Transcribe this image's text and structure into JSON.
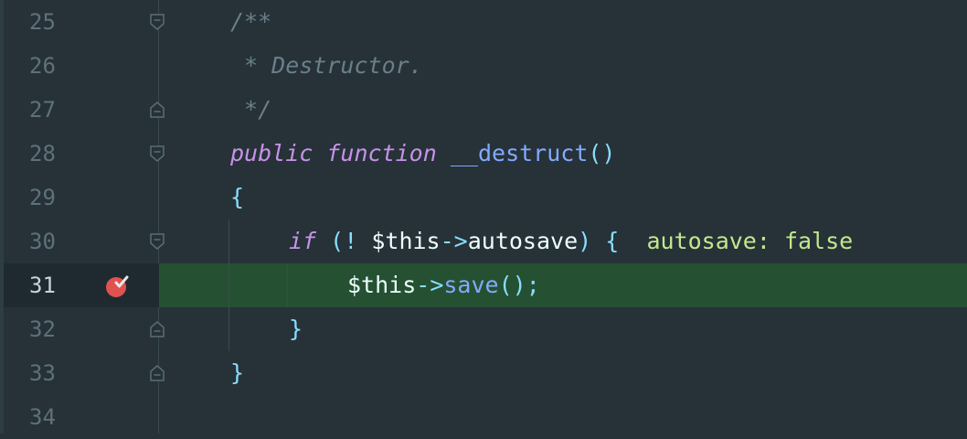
{
  "editor": {
    "colors": {
      "background": "#263238",
      "current_line": "#255132",
      "comment": "#6a7f89",
      "keyword": "#c792ea",
      "function": "#82aaff",
      "punctuation": "#89ddff",
      "inline_value": "#c3e88d",
      "breakpoint": "#e0524f"
    },
    "current_line": "31",
    "lines": [
      {
        "number": "25",
        "comment": "/**"
      },
      {
        "number": "26",
        "comment": " * Destructor."
      },
      {
        "number": "27",
        "comment": " */"
      },
      {
        "number": "28",
        "kw1": "public",
        "kw2": "function",
        "fname": "__destruct",
        "parens": "()"
      },
      {
        "number": "29",
        "brace": "{"
      },
      {
        "number": "30",
        "kw": "if",
        "open": "(!",
        "var": "$this",
        "arrow": "->",
        "prop": "autosave",
        "close": ")",
        "brace": "{",
        "inline_value": "autosave: false"
      },
      {
        "number": "31",
        "var": "$this",
        "arrow": "->",
        "method": "save",
        "call": "();"
      },
      {
        "number": "32",
        "brace": "}"
      },
      {
        "number": "33",
        "brace": "}"
      },
      {
        "number": "34"
      }
    ],
    "icons": {
      "breakpoint": "breakpoint-icon",
      "fold_open": "fold-open-icon",
      "fold_close": "fold-close-icon"
    }
  }
}
